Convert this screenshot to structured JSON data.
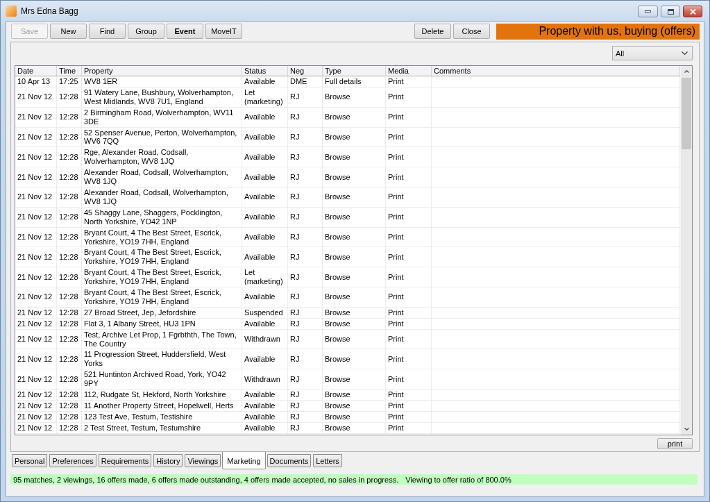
{
  "window": {
    "title": "Mrs Edna Bagg"
  },
  "toolbar": {
    "buttons": [
      {
        "label": "Save",
        "disabled": true,
        "emphasized": false
      },
      {
        "label": "New",
        "disabled": false,
        "emphasized": false
      },
      {
        "label": "Find",
        "disabled": false,
        "emphasized": false
      },
      {
        "label": "Group",
        "disabled": false,
        "emphasized": false
      },
      {
        "label": "Event",
        "disabled": false,
        "emphasized": true
      },
      {
        "label": "MoveIT",
        "disabled": false,
        "emphasized": false
      }
    ],
    "actions": [
      {
        "label": "Delete"
      },
      {
        "label": "Close"
      }
    ],
    "banner": "Property with us, buying (offers)"
  },
  "filter": {
    "value": "All"
  },
  "table": {
    "columns": [
      "Date",
      "Time",
      "Property",
      "Status",
      "Neg",
      "Type",
      "Media",
      "Comments"
    ],
    "rows": [
      {
        "date": "10 Apr 13",
        "time": "17:25",
        "property": "WV8 1ER",
        "status": "Available",
        "neg": "DME",
        "type": "Full details",
        "media": "Print"
      },
      {
        "date": "21 Nov 12",
        "time": "12:28",
        "property": "91 Watery Lane, Bushbury, Wolverhampton, West Midlands, WV8 7U1, England",
        "status": "Let (marketing)",
        "neg": "RJ",
        "type": "Browse",
        "media": "Print"
      },
      {
        "date": "21 Nov 12",
        "time": "12:28",
        "property": "2 Birmingham Road, Wolverhampton, WV11 3DE",
        "status": "Available",
        "neg": "RJ",
        "type": "Browse",
        "media": "Print"
      },
      {
        "date": "21 Nov 12",
        "time": "12:28",
        "property": "52 Spenser Avenue, Perton, Wolverhampton, WV6 7QQ",
        "status": "Available",
        "neg": "RJ",
        "type": "Browse",
        "media": "Print"
      },
      {
        "date": "21 Nov 12",
        "time": "12:28",
        "property": "Rge, Alexander Road, Codsall, Wolverhampton, WV8 1JQ",
        "status": "Available",
        "neg": "RJ",
        "type": "Browse",
        "media": "Print"
      },
      {
        "date": "21 Nov 12",
        "time": "12:28",
        "property": "Alexander Road, Codsall, Wolverhampton, WV8 1JQ",
        "status": "Available",
        "neg": "RJ",
        "type": "Browse",
        "media": "Print"
      },
      {
        "date": "21 Nov 12",
        "time": "12:28",
        "property": "Alexander Road, Codsall, Wolverhampton, WV8 1JQ",
        "status": "Available",
        "neg": "RJ",
        "type": "Browse",
        "media": "Print"
      },
      {
        "date": "21 Nov 12",
        "time": "12:28",
        "property": "45 Shaggy Lane, Shaggers, Pocklington, North Yorkshire, YO42 1NP",
        "status": "Available",
        "neg": "RJ",
        "type": "Browse",
        "media": "Print"
      },
      {
        "date": "21 Nov 12",
        "time": "12:28",
        "property": "Bryant Court, 4 The Best Street, Escrick, Yorkshire, YO19 7HH, England",
        "status": "Available",
        "neg": "RJ",
        "type": "Browse",
        "media": "Print"
      },
      {
        "date": "21 Nov 12",
        "time": "12:28",
        "property": "Bryant Court, 4 The Best Street, Escrick, Yorkshire, YO19 7HH, England",
        "status": "Available",
        "neg": "RJ",
        "type": "Browse",
        "media": "Print"
      },
      {
        "date": "21 Nov 12",
        "time": "12:28",
        "property": "Bryant Court, 4 The Best Street, Escrick, Yorkshire, YO19 7HH, England",
        "status": "Let (marketing)",
        "neg": "RJ",
        "type": "Browse",
        "media": "Print"
      },
      {
        "date": "21 Nov 12",
        "time": "12:28",
        "property": "Bryant Court, 4 The Best Street, Escrick, Yorkshire, YO19 7HH, England",
        "status": "Available",
        "neg": "RJ",
        "type": "Browse",
        "media": "Print"
      },
      {
        "date": "21 Nov 12",
        "time": "12:28",
        "property": "27 Broad Street, Jep, Jefordshire",
        "status": "Suspended",
        "neg": "RJ",
        "type": "Browse",
        "media": "Print"
      },
      {
        "date": "21 Nov 12",
        "time": "12:28",
        "property": "Flat 3, 1 Albany Street, HU3 1PN",
        "status": "Available",
        "neg": "RJ",
        "type": "Browse",
        "media": "Print"
      },
      {
        "date": "21 Nov 12",
        "time": "12:28",
        "property": "Test, Archive Let Prop, 1 Fgrbthth, The Town, The Country",
        "status": "Withdrawn",
        "neg": "RJ",
        "type": "Browse",
        "media": "Print"
      },
      {
        "date": "21 Nov 12",
        "time": "12:28",
        "property": "11 Progression Street, Huddersfield, West Yorks",
        "status": "Available",
        "neg": "RJ",
        "type": "Browse",
        "media": "Print"
      },
      {
        "date": "21 Nov 12",
        "time": "12:28",
        "property": "521 Huntinton Archived Road, York, YO42 9PY",
        "status": "Withdrawn",
        "neg": "RJ",
        "type": "Browse",
        "media": "Print"
      },
      {
        "date": "21 Nov 12",
        "time": "12:28",
        "property": "112, Rudgate St, Hekford, North Yorkshire",
        "status": "Available",
        "neg": "RJ",
        "type": "Browse",
        "media": "Print"
      },
      {
        "date": "21 Nov 12",
        "time": "12:28",
        "property": "11 Another Property Street, Hopelwell, Herts",
        "status": "Available",
        "neg": "RJ",
        "type": "Browse",
        "media": "Print"
      },
      {
        "date": "21 Nov 12",
        "time": "12:28",
        "property": "123 Test Ave, Testum, Testishire",
        "status": "Available",
        "neg": "RJ",
        "type": "Browse",
        "media": "Print"
      },
      {
        "date": "21 Nov 12",
        "time": "12:28",
        "property": "2 Test Street, Testum, Testumshire",
        "status": "Available",
        "neg": "RJ",
        "type": "Browse",
        "media": "Print"
      }
    ]
  },
  "print_button": {
    "label": "print"
  },
  "tabs": [
    {
      "label": "Personal",
      "selected": false
    },
    {
      "label": "Preferences",
      "selected": false
    },
    {
      "label": "Requirements",
      "selected": false
    },
    {
      "label": "History",
      "selected": false
    },
    {
      "label": "Viewings",
      "selected": false
    },
    {
      "label": "Marketing",
      "selected": true
    },
    {
      "label": "Documents",
      "selected": false
    },
    {
      "label": "Letters",
      "selected": false
    }
  ],
  "status_bar": {
    "summary": "95 matches, 2 viewings, 16 offers made, 6 offers made outstanding, 4 offers made accepted, no sales in progress.",
    "ratio": "Viewing to offer ratio of 800.0%"
  }
}
